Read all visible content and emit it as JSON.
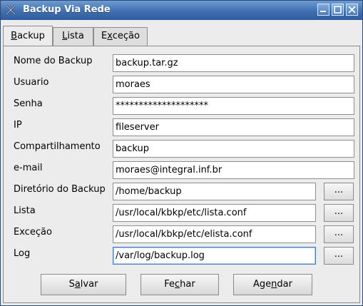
{
  "window": {
    "title": "Backup Via Rede"
  },
  "tabs": [
    {
      "pre": "",
      "mnemonic": "B",
      "post": "ackup"
    },
    {
      "pre": "",
      "mnemonic": "L",
      "post": "ista"
    },
    {
      "pre": "E",
      "mnemonic": "x",
      "post": "ceção"
    }
  ],
  "form": {
    "nome_label": "Nome do Backup",
    "nome_value": "backup.tar.gz",
    "usuario_label": "Usuario",
    "usuario_value": "moraes",
    "senha_label": "Senha",
    "senha_value": "********************",
    "ip_label": "IP",
    "ip_value": "fileserver",
    "comp_label": "Compartilhamento",
    "comp_value": "backup",
    "email_label": "e-mail",
    "email_value": "moraes@integral.inf.br",
    "dir_label": "Diretório do Backup",
    "dir_value": "/home/backup",
    "lista_label": "Lista",
    "lista_value": "/usr/local/kbkp/etc/lista.conf",
    "excecao_label": "Exceção",
    "excecao_value": "/usr/local/kbkp/etc/elista.conf",
    "log_label": "Log",
    "log_value": "/var/log/backup.log",
    "browse_label": "..."
  },
  "buttons": {
    "salvar": {
      "pre": "S",
      "mnemonic": "a",
      "post": "lvar"
    },
    "fechar": {
      "pre": "Fe",
      "mnemonic": "c",
      "post": "har"
    },
    "agendar": {
      "pre": "Age",
      "mnemonic": "n",
      "post": "dar"
    }
  }
}
